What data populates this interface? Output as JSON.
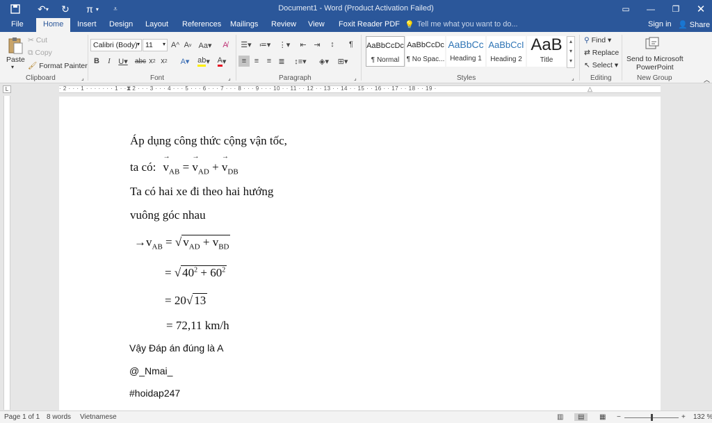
{
  "quick_access": {
    "save": "save-icon",
    "undo": "undo-icon",
    "redo": "redo-icon",
    "pi": "π",
    "more": "⌄"
  },
  "window_title": "Document1 - Word (Product Activation Failed)",
  "tabs": [
    "File",
    "Home",
    "Insert",
    "Design",
    "Layout",
    "References",
    "Mailings",
    "Review",
    "View",
    "Foxit Reader PDF"
  ],
  "tell_me": "Tell me what you want to do...",
  "sign_in": "Sign in",
  "share": "Share",
  "clipboard": {
    "paste": "Paste",
    "cut": "Cut",
    "copy": "Copy",
    "format_painter": "Format Painter",
    "label": "Clipboard"
  },
  "font": {
    "name": "Calibri (Body)",
    "size": "11",
    "label": "Font"
  },
  "paragraph": {
    "label": "Paragraph"
  },
  "styles": {
    "items": [
      {
        "preview": "AaBbCcDc",
        "name": "¶ Normal"
      },
      {
        "preview": "AaBbCcDc",
        "name": "¶ No Spac..."
      },
      {
        "preview": "AaBbCc",
        "name": "Heading 1"
      },
      {
        "preview": "AaBbCcI",
        "name": "Heading 2"
      },
      {
        "preview": "AaB",
        "name": "Title"
      }
    ],
    "label": "Styles"
  },
  "editing": {
    "find": "Find",
    "replace": "Replace",
    "select": "Select",
    "label": "Editing"
  },
  "new_group": {
    "send": "Send to Microsoft",
    "send2": "PowerPoint",
    "label": "New Group"
  },
  "ruler": {
    "h": "· 2 · · · 1 · · · · · · · 1 · · · 2 · · · 3 · · · 4 · · · 5 · · · 6 · · · 7 · · · 8 · · · 9 · · · 10 · · 11 · · 12 · · 13 · · 14 · · 15 · · 16 · · 17 · · 18 · · 19 ·"
  },
  "doc": {
    "l1": "Áp dụng công thức cộng vận tốc,",
    "l2_prefix": "ta có:",
    "l3": "Ta có hai xe đi theo hai hướng",
    "l4": "vuông góc nhau",
    "l9": "Vậy Đáp án đúng là A",
    "l10": "@_Nmai_",
    "l11": "#hoidap247",
    "eq": {
      "v": "v",
      "ab": "AB",
      "ad": "AD",
      "db": "DB",
      "bd": "BD",
      "n40": "40",
      "n60": "60",
      "two": "2",
      "n20": "20",
      "n13": "13",
      "result": "= 72,11 km/h"
    }
  },
  "status": {
    "page": "Page 1 of 1",
    "words": "8 words",
    "lang": "Vietnamese",
    "zoom": "132 %"
  }
}
